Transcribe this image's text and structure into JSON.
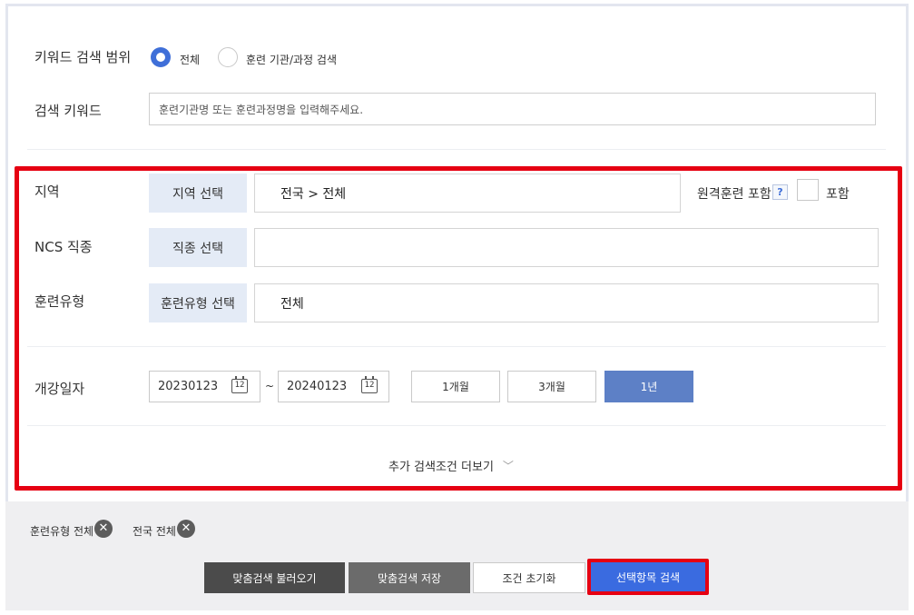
{
  "keyword_scope": {
    "label": "키워드 검색 범위",
    "options": [
      {
        "label": "전체",
        "checked": true
      },
      {
        "label": "훈련 기관/과정 검색",
        "checked": false
      }
    ]
  },
  "keyword": {
    "label": "검색 키워드",
    "placeholder": "훈련기관명 또는 훈련과정명을 입력해주세요."
  },
  "region": {
    "label": "지역",
    "select_label": "지역 선택",
    "value": "전국 > 전체",
    "remote_label": "원격훈련 포함",
    "help": "?",
    "include_label": "포함"
  },
  "ncs": {
    "label": "NCS 직종",
    "select_label": "직종 선택",
    "value": ""
  },
  "training_type": {
    "label": "훈련유형",
    "select_label": "훈련유형 선택",
    "value": "전체"
  },
  "start_date": {
    "label": "개강일자",
    "from": "20230123",
    "separator": "~",
    "to": "20240123",
    "calendar_glyph": "12",
    "periods": [
      "1개월",
      "3개월",
      "1년"
    ],
    "active_period": "1년"
  },
  "more": {
    "label": "추가 검색조건 더보기",
    "chevron": "﹀"
  },
  "chips": [
    {
      "label": "훈련유형 전체",
      "close": "✕"
    },
    {
      "label": "전국 전체",
      "close": "✕"
    }
  ],
  "actions": {
    "load": "맞춤검색 불러오기",
    "save": "맞춤검색 저장",
    "reset": "조건 초기화",
    "search": "선택항목 검색"
  },
  "colors": {
    "accent": "#3f6fd8",
    "highlight": "#e60012",
    "select_bg": "#e4ebf6",
    "active_period": "#5d80c6",
    "dark_button": "#4b4b4b",
    "mid_button": "#6b6b6b",
    "search_button": "#3a6be0"
  }
}
